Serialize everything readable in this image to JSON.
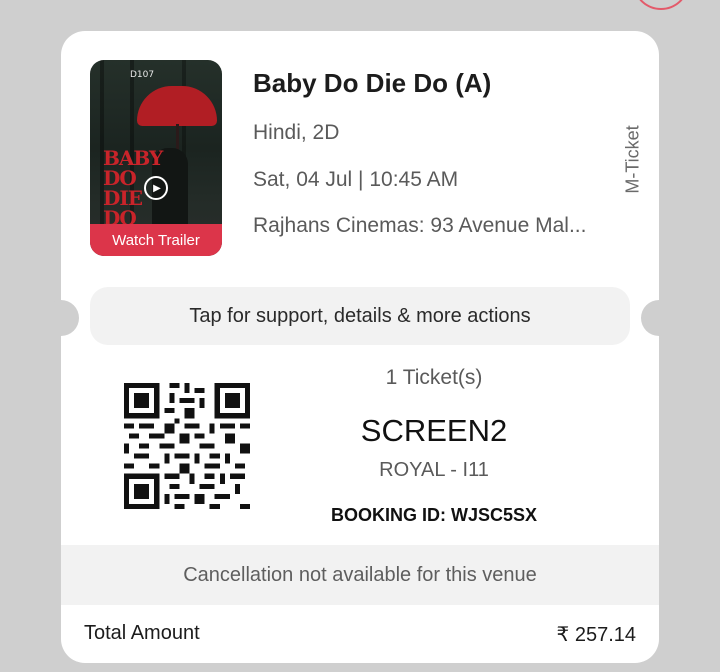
{
  "poster": {
    "tag": "D107",
    "title_art": "BABY DO DIE DO",
    "trailer_label": "Watch Trailer"
  },
  "movie": {
    "title": "Baby Do Die Do (A)",
    "language_format": "Hindi, 2D",
    "datetime": "Sat, 04 Jul | 10:45 AM",
    "venue": "Rajhans Cinemas: 93 Avenue Mal..."
  },
  "ticket_type": "M-Ticket",
  "support_label": "Tap for support, details & more actions",
  "booking": {
    "ticket_count": "1 Ticket(s)",
    "screen": "SCREEN2",
    "seat": "ROYAL - I11",
    "booking_id": "BOOKING ID: WJSC5SX"
  },
  "cancellation_note": "Cancellation not available for this venue",
  "total": {
    "label": "Total Amount",
    "value": "₹ 257.14"
  },
  "icons": [
    "play-icon",
    "qr-code-icon"
  ],
  "colors": {
    "accent": "#dc354a",
    "background": "#cfcfcf",
    "card": "#ffffff",
    "panel": "#f2f2f2"
  }
}
